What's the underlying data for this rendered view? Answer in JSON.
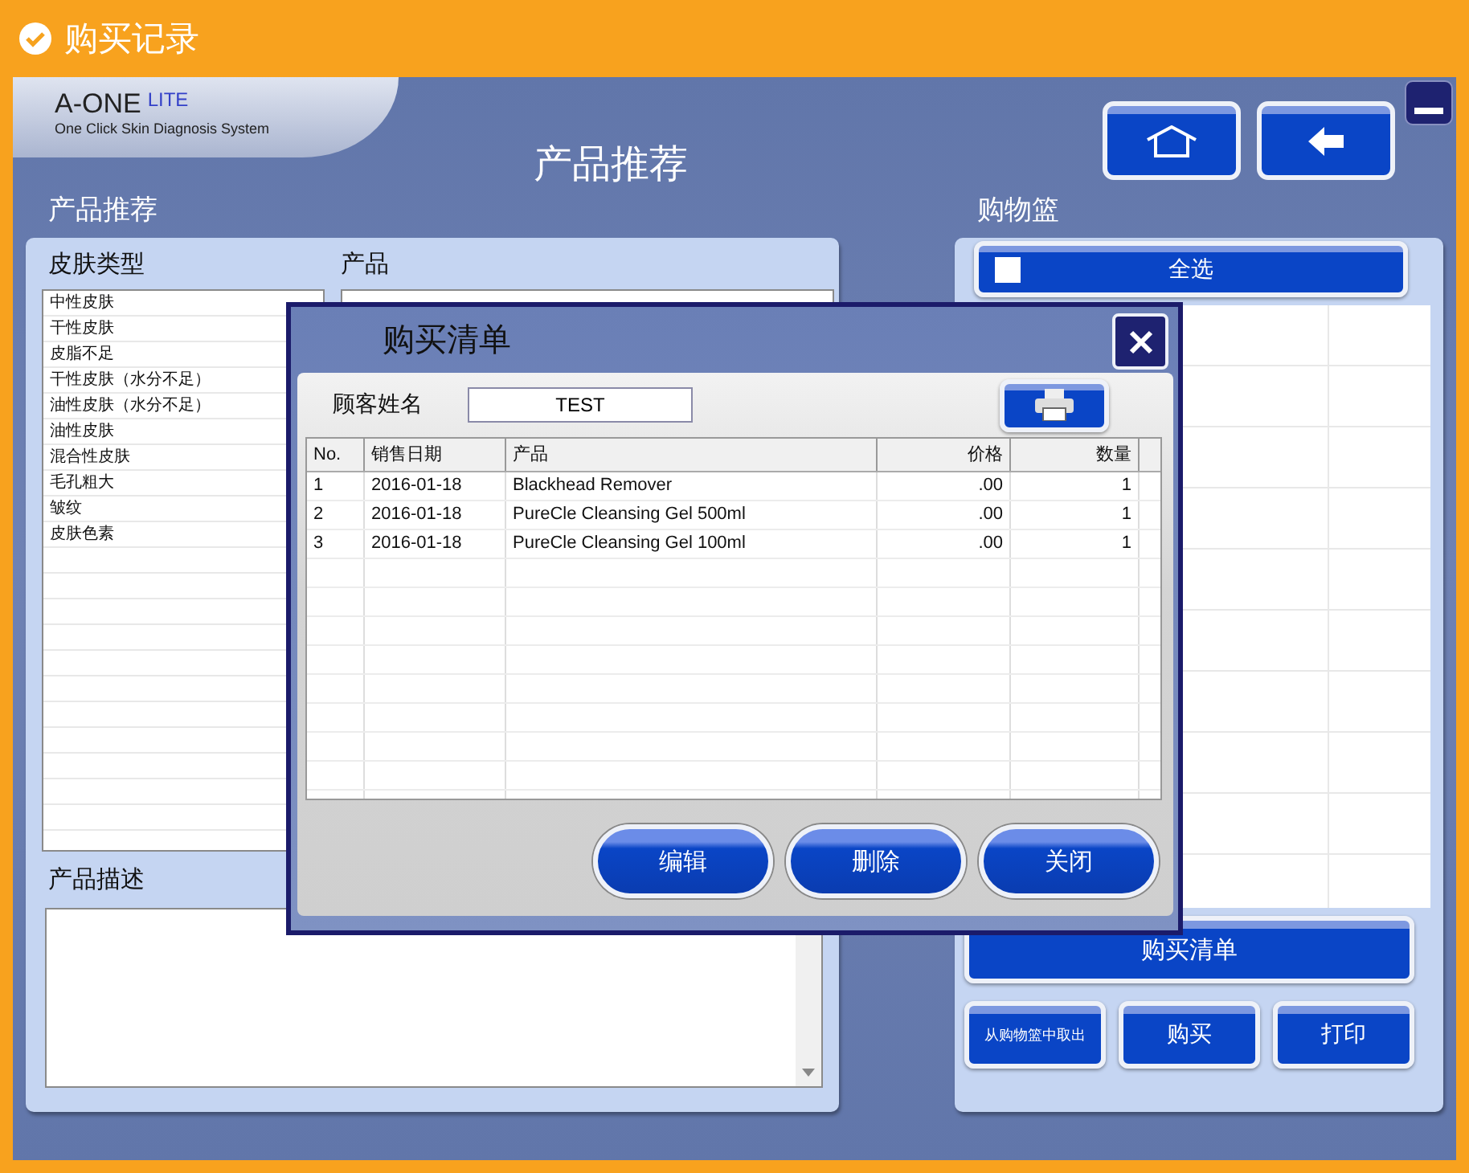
{
  "title_bar": {
    "title": "购买记录"
  },
  "logo": {
    "name": "A-ONE",
    "edition": "LITE",
    "tagline": "One Click Skin Diagnosis System"
  },
  "page_title": "产品推荐",
  "recommendation": {
    "heading": "产品推荐",
    "skin_type_label": "皮肤类型",
    "product_label": "产品",
    "description_label": "产品描述",
    "skin_types": [
      {
        "label": "中性皮肤",
        "selected": false
      },
      {
        "label": "干性皮肤",
        "selected": false
      },
      {
        "label": "皮脂不足",
        "selected": false
      },
      {
        "label": "干性皮肤（水分不足）",
        "selected": false
      },
      {
        "label": "油性皮肤（水分不足）",
        "selected": false
      },
      {
        "label": "油性皮肤",
        "selected": false
      },
      {
        "label": "混合性皮肤",
        "selected": false
      },
      {
        "label": "毛孔粗大",
        "selected": false
      },
      {
        "label": "皱纹",
        "selected": false
      },
      {
        "label": "皮肤色素",
        "selected": false
      }
    ]
  },
  "basket": {
    "heading": "购物篮",
    "select_all": {
      "label": "全选",
      "checked": false
    },
    "purchase_list_button": "购买清单",
    "buttons": [
      "从购物篮中取出",
      "购买",
      "打印"
    ]
  },
  "dialog": {
    "title": "购买清单",
    "customer_label": "顾客姓名",
    "customer_name": "TEST",
    "columns": [
      "No.",
      "销售日期",
      "产品",
      "价格",
      "数量"
    ],
    "rows": [
      [
        "1",
        "2016-01-18",
        "Blackhead Remover",
        ".00",
        "1"
      ],
      [
        "2",
        "2016-01-18",
        "PureCle Cleansing Gel 500ml",
        ".00",
        "1"
      ],
      [
        "3",
        "2016-01-18",
        "PureCle Cleansing Gel 100ml",
        ".00",
        "1"
      ]
    ],
    "buttons": [
      "编辑",
      "删除",
      "关闭"
    ]
  }
}
